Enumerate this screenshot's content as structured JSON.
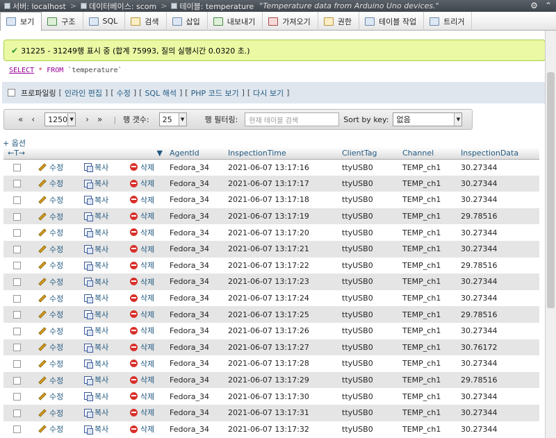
{
  "breadcrumb": {
    "server": "서버: localhost",
    "database": "데이터베이스: scom",
    "table": "테이블: temperature",
    "comment": "\"Temperature data from Arduino Uno devices.\""
  },
  "tabs": [
    {
      "label": "보기",
      "active": true
    },
    {
      "label": "구조"
    },
    {
      "label": "SQL"
    },
    {
      "label": "검색"
    },
    {
      "label": "삽입"
    },
    {
      "label": "내보내기"
    },
    {
      "label": "가져오기"
    },
    {
      "label": "권한"
    },
    {
      "label": "테이블 작업"
    },
    {
      "label": "트리거"
    }
  ],
  "message": "31225 - 31249행 표시 중 (합계 75993, 질의 실행시간 0.0320 초.)",
  "sql": {
    "select": "SELECT",
    "star": "*",
    "from": "FROM",
    "table": "`temperature`"
  },
  "profiling": {
    "label": "프로파일링",
    "links": [
      "인라인 편집",
      "수정",
      "SQL 해석",
      "PHP 코드 보기",
      "다시 보기"
    ]
  },
  "navigation": {
    "page": "1250",
    "rows_label": "행 갯수:",
    "rows_value": "25",
    "filter_label": "행 필터링:",
    "filter_placeholder": "현재 테이블 검색",
    "sort_label": "Sort by key:",
    "sort_value": "없음"
  },
  "options_label": "+ 옵션",
  "columns": [
    "AgentId",
    "InspectionTime",
    "ClientTag",
    "Channel",
    "InspectionData"
  ],
  "actions": {
    "edit": "수정",
    "copy": "복사",
    "delete": "삭제"
  },
  "rows": [
    [
      "Fedora_34",
      "2021-06-07 13:17:16",
      "ttyUSB0",
      "TEMP_ch1",
      "30.27344"
    ],
    [
      "Fedora_34",
      "2021-06-07 13:17:17",
      "ttyUSB0",
      "TEMP_ch1",
      "30.27344"
    ],
    [
      "Fedora_34",
      "2021-06-07 13:17:18",
      "ttyUSB0",
      "TEMP_ch1",
      "30.27344"
    ],
    [
      "Fedora_34",
      "2021-06-07 13:17:19",
      "ttyUSB0",
      "TEMP_ch1",
      "29.78516"
    ],
    [
      "Fedora_34",
      "2021-06-07 13:17:20",
      "ttyUSB0",
      "TEMP_ch1",
      "30.27344"
    ],
    [
      "Fedora_34",
      "2021-06-07 13:17:21",
      "ttyUSB0",
      "TEMP_ch1",
      "30.27344"
    ],
    [
      "Fedora_34",
      "2021-06-07 13:17:22",
      "ttyUSB0",
      "TEMP_ch1",
      "29.78516"
    ],
    [
      "Fedora_34",
      "2021-06-07 13:17:23",
      "ttyUSB0",
      "TEMP_ch1",
      "30.27344"
    ],
    [
      "Fedora_34",
      "2021-06-07 13:17:24",
      "ttyUSB0",
      "TEMP_ch1",
      "30.27344"
    ],
    [
      "Fedora_34",
      "2021-06-07 13:17:25",
      "ttyUSB0",
      "TEMP_ch1",
      "29.78516"
    ],
    [
      "Fedora_34",
      "2021-06-07 13:17:26",
      "ttyUSB0",
      "TEMP_ch1",
      "30.27344"
    ],
    [
      "Fedora_34",
      "2021-06-07 13:17:27",
      "ttyUSB0",
      "TEMP_ch1",
      "30.76172"
    ],
    [
      "Fedora_34",
      "2021-06-07 13:17:28",
      "ttyUSB0",
      "TEMP_ch1",
      "30.27344"
    ],
    [
      "Fedora_34",
      "2021-06-07 13:17:29",
      "ttyUSB0",
      "TEMP_ch1",
      "29.78516"
    ],
    [
      "Fedora_34",
      "2021-06-07 13:17:30",
      "ttyUSB0",
      "TEMP_ch1",
      "30.27344"
    ],
    [
      "Fedora_34",
      "2021-06-07 13:17:31",
      "ttyUSB0",
      "TEMP_ch1",
      "30.27344"
    ],
    [
      "Fedora_34",
      "2021-06-07 13:17:32",
      "ttyUSB0",
      "TEMP_ch1",
      "30.27344"
    ]
  ]
}
